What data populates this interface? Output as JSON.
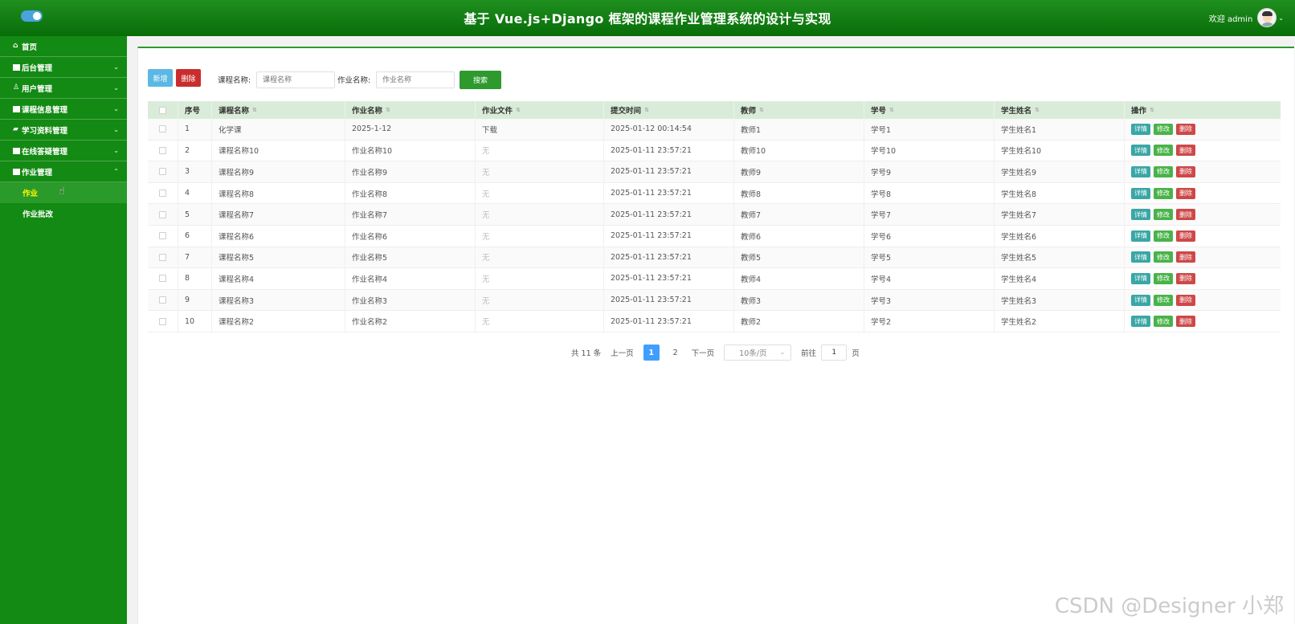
{
  "header": {
    "title": "基于 Vue.js+Django 框架的课程作业管理系统的设计与实现",
    "welcome": "欢迎 admin",
    "accent": "#138a13"
  },
  "sidebar": {
    "home": "首页",
    "items": [
      {
        "label": "后台管理",
        "icon": "grid-icon"
      },
      {
        "label": "用户管理",
        "icon": "user-icon"
      },
      {
        "label": "课程信息管理",
        "icon": "grid-icon"
      },
      {
        "label": "学习资料管理",
        "icon": "folder-icon"
      },
      {
        "label": "在线答疑管理",
        "icon": "grid-icon"
      },
      {
        "label": "作业管理",
        "icon": "grid-icon"
      }
    ],
    "sub_items": [
      "作业",
      "作业批改"
    ]
  },
  "toolbar": {
    "add_label": "新增",
    "delete_label": "删除",
    "course_label": "课程名称:",
    "course_placeholder": "课程名称",
    "homework_label": "作业名称:",
    "homework_placeholder": "作业名称",
    "search_label": "搜索"
  },
  "table": {
    "headers": [
      "序号",
      "课程名称",
      "作业名称",
      "作业文件",
      "提交时间",
      "教师",
      "学号",
      "学生姓名",
      "操作"
    ],
    "rows": [
      {
        "idx": "1",
        "course": "化学课",
        "homework": "2025-1-12",
        "file": "下载",
        "time": "2025-01-12 00:14:54",
        "teacher": "教师1",
        "sno": "学号1",
        "sname": "学生姓名1"
      },
      {
        "idx": "2",
        "course": "课程名称10",
        "homework": "作业名称10",
        "file": "无",
        "time": "2025-01-11 23:57:21",
        "teacher": "教师10",
        "sno": "学号10",
        "sname": "学生姓名10"
      },
      {
        "idx": "3",
        "course": "课程名称9",
        "homework": "作业名称9",
        "file": "无",
        "time": "2025-01-11 23:57:21",
        "teacher": "教师9",
        "sno": "学号9",
        "sname": "学生姓名9"
      },
      {
        "idx": "4",
        "course": "课程名称8",
        "homework": "作业名称8",
        "file": "无",
        "time": "2025-01-11 23:57:21",
        "teacher": "教师8",
        "sno": "学号8",
        "sname": "学生姓名8"
      },
      {
        "idx": "5",
        "course": "课程名称7",
        "homework": "作业名称7",
        "file": "无",
        "time": "2025-01-11 23:57:21",
        "teacher": "教师7",
        "sno": "学号7",
        "sname": "学生姓名7"
      },
      {
        "idx": "6",
        "course": "课程名称6",
        "homework": "作业名称6",
        "file": "无",
        "time": "2025-01-11 23:57:21",
        "teacher": "教师6",
        "sno": "学号6",
        "sname": "学生姓名6"
      },
      {
        "idx": "7",
        "course": "课程名称5",
        "homework": "作业名称5",
        "file": "无",
        "time": "2025-01-11 23:57:21",
        "teacher": "教师5",
        "sno": "学号5",
        "sname": "学生姓名5"
      },
      {
        "idx": "8",
        "course": "课程名称4",
        "homework": "作业名称4",
        "file": "无",
        "time": "2025-01-11 23:57:21",
        "teacher": "教师4",
        "sno": "学号4",
        "sname": "学生姓名4"
      },
      {
        "idx": "9",
        "course": "课程名称3",
        "homework": "作业名称3",
        "file": "无",
        "time": "2025-01-11 23:57:21",
        "teacher": "教师3",
        "sno": "学号3",
        "sname": "学生姓名3"
      },
      {
        "idx": "10",
        "course": "课程名称2",
        "homework": "作业名称2",
        "file": "无",
        "time": "2025-01-11 23:57:21",
        "teacher": "教师2",
        "sno": "学号2",
        "sname": "学生姓名2"
      }
    ],
    "actions": {
      "detail": "详情",
      "edit": "修改",
      "delete": "删除"
    }
  },
  "pagination": {
    "total": "共 11 条",
    "prev": "上一页",
    "pages": [
      "1",
      "2"
    ],
    "current": "1",
    "next": "下一页",
    "page_size": "10条/页",
    "goto": "前往",
    "goto_value": "1",
    "page_unit": "页"
  },
  "watermark": "CSDN @Designer 小郑"
}
